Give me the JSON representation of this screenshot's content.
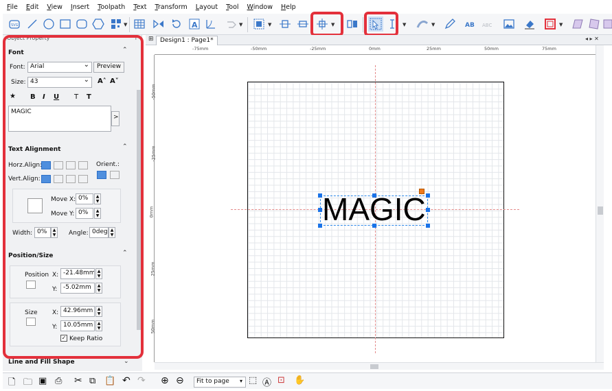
{
  "menu": [
    "File",
    "Edit",
    "View",
    "Insert",
    "Toolpath",
    "Text",
    "Transform",
    "Layout",
    "Tool",
    "Window",
    "Help"
  ],
  "toolbar": {
    "icons": [
      "svg-import-icon",
      "line-icon",
      "circle-icon",
      "rectangle-icon",
      "hexagon-icon",
      "qrcode-icon",
      "table-icon",
      "mirror-icon",
      "rotate-icon",
      "text-icon",
      "wrap-text-icon",
      "weld-icon",
      "align-left-icon",
      "align-center-h-icon",
      "align-center-icon",
      "distribute-icon",
      "select-icon",
      "cursor-text-icon",
      "bend-icon",
      "pen-icon",
      "ab-icon",
      "abc-icon",
      "image-icon",
      "eraser-icon",
      "frame-icon",
      "skew-icon",
      "3d-icon"
    ]
  },
  "panel": {
    "header": "Object Property",
    "font_section": "Font",
    "font_label": "Font:",
    "font_value": "Arial",
    "preview_button": "Preview",
    "size_label": "Size:",
    "size_value": "43",
    "style_b": "B",
    "style_i": "I",
    "style_u": "U",
    "style_t1": "T",
    "style_t2": "T",
    "text_content": "MAGIC",
    "text_more": ">",
    "align_section": "Text Alignment",
    "horz_label": "Horz.Align:",
    "vert_label": "Vert.Align:",
    "orient_label": "Orient.:",
    "move_x_label": "Move X:",
    "move_x": "0%",
    "move_y_label": "Move Y:",
    "move_y": "0%",
    "width_label": "Width:",
    "width_value": "0%",
    "angle_label": "Angle:",
    "angle_value": "0deg",
    "pos_section": "Position/Size",
    "position_label": "Position",
    "pos_x_label": "X:",
    "pos_x": "-21.48mm",
    "pos_y_label": "Y:",
    "pos_y": "-5.02mm",
    "size2_label": "Size",
    "size_x_label": "X:",
    "size_x": "42.96mm",
    "size_y_label": "Y:",
    "size_y": "10.05mm",
    "keep_ratio": "Keep Ratio",
    "keep_ratio_checked": true,
    "line_fill_section": "Line and Fill Shape"
  },
  "document": {
    "tab": "Design1 : Page1*",
    "text": "MAGIC",
    "h_ruler": [
      "-75mm",
      "-50mm",
      "-25mm",
      "0mm",
      "25mm",
      "50mm",
      "75mm"
    ],
    "v_ruler": [
      "-50mm",
      "-25mm",
      "0mm",
      "25mm",
      "50mm"
    ]
  },
  "statusbar": {
    "zoom": "Fit to page"
  },
  "colors": {
    "highlight": "#e3303b",
    "selection": "#2a86e8",
    "rotate_handle": "#f07a1a"
  }
}
